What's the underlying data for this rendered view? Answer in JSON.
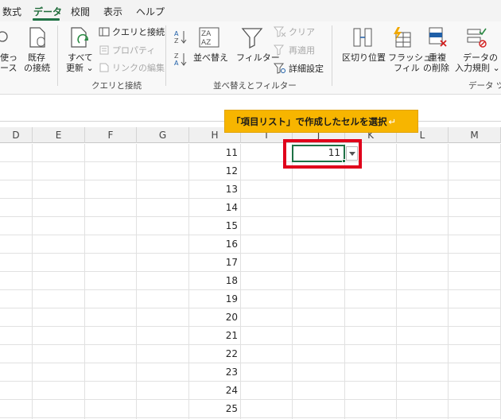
{
  "menu": {
    "tabs": [
      "数式",
      "データ",
      "校閲",
      "表示",
      "ヘルプ"
    ],
    "active": "データ"
  },
  "ribbon": {
    "partial_left_line1": "使っ",
    "partial_left_line2": "ース",
    "existing_line1": "既存",
    "existing_line2": "の接続",
    "refresh_line1": "すべて",
    "refresh_line2": "更新 ⌄",
    "queries_connections": "クエリと接続",
    "properties": "プロパティ",
    "edit_links": "リンクの編集",
    "group_queries": "クエリと接続",
    "sort": "並べ替え",
    "filter": "フィルター",
    "clear": "クリア",
    "reapply": "再適用",
    "advanced": "詳細設定",
    "group_sort_filter": "並べ替えとフィルター",
    "text_to_columns": "区切り位置",
    "flash_fill_line1": "フラッシュ",
    "flash_fill_line2": "フィル",
    "remove_dup_line1": "重複",
    "remove_dup_line2": "の削除",
    "validation_line1": "データの",
    "validation_line2": "入力規則 ⌄",
    "group_data_tools": "データ ツー"
  },
  "columns": [
    "D",
    "E",
    "F",
    "G",
    "H",
    "I",
    "J",
    "K",
    "L",
    "M"
  ],
  "rows": [
    "11",
    "12",
    "13",
    "14",
    "15",
    "16",
    "17",
    "18",
    "19",
    "20",
    "21",
    "22",
    "23",
    "24",
    "25"
  ],
  "active_cell": {
    "value": "11"
  },
  "callout": {
    "text": "「項目リスト」で作成したセルを選択",
    "return_mark": "↵"
  },
  "colors": {
    "accent": "#217346",
    "callout": "#f7b500",
    "highlight": "#e0001b"
  }
}
